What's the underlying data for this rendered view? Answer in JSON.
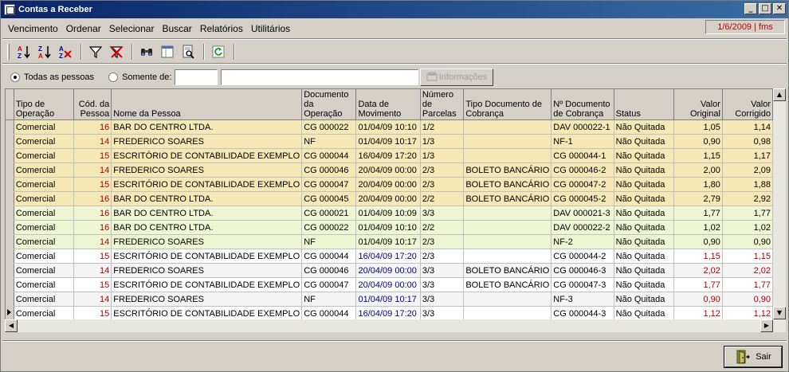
{
  "window": {
    "title": "Contas a Receber",
    "minimize": "_",
    "maximize": "□",
    "close": "✕"
  },
  "menu": [
    {
      "label": "Vencimento"
    },
    {
      "label": "Ordenar"
    },
    {
      "label": "Selecionar"
    },
    {
      "label": "Buscar"
    },
    {
      "label": "Relatórios"
    },
    {
      "label": "Utilitários"
    }
  ],
  "date_user": "1/6/2009 | fms",
  "toolbar": {
    "sort_asc": "sort-ascending-icon",
    "sort_desc": "sort-descending-icon",
    "clear_sort": "clear-sort-icon",
    "filter": "filter-icon",
    "clear_filter": "clear-filter-icon",
    "find": "binoculars-icon",
    "columns": "columns-icon",
    "preview": "print-preview-icon",
    "refresh": "refresh-icon"
  },
  "filter": {
    "all_label": "Todas as pessoas",
    "only_label": "Somente de:",
    "code_value": "",
    "name_value": "",
    "info_button": "Informações"
  },
  "table": {
    "headers": [
      "Tipo de Operação",
      "Cód. da Pessoa",
      "Nome da Pessoa",
      "Documento da Operação",
      "Data de Movimento",
      "Número de Parcelas",
      "Tipo Documento de Cobrança",
      "Nº Documento de Cobrança",
      "Status",
      "Valor Original",
      "Valor Corrigido"
    ],
    "rows": [
      {
        "tipo": "Comercial",
        "cod": "16",
        "nome": "BAR DO CENTRO LTDA.",
        "doc": "CG 000022",
        "data": "01/04/09 10:10",
        "parc": "1/2",
        "tipodoc": "",
        "ndoc": "DAV 000022-1",
        "status": "Não Quitada",
        "vorig": "1,05",
        "vcorr": "1,14"
      },
      {
        "tipo": "Comercial",
        "cod": "14",
        "nome": "FREDERICO SOARES",
        "doc": "NF",
        "data": "01/04/09 10:17",
        "parc": "1/3",
        "tipodoc": "",
        "ndoc": "NF-1",
        "status": "Não Quitada",
        "vorig": "0,90",
        "vcorr": "0,98"
      },
      {
        "tipo": "Comercial",
        "cod": "15",
        "nome": "ESCRITÓRIO DE CONTABILIDADE EXEMPLO",
        "doc": "CG 000044",
        "data": "16/04/09 17:20",
        "parc": "1/3",
        "tipodoc": "",
        "ndoc": "CG 000044-1",
        "status": "Não Quitada",
        "vorig": "1,15",
        "vcorr": "1,17"
      },
      {
        "tipo": "Comercial",
        "cod": "14",
        "nome": "FREDERICO SOARES",
        "doc": "CG 000046",
        "data": "20/04/09 00:00",
        "parc": "2/3",
        "tipodoc": "BOLETO BANCÁRIO",
        "ndoc": "CG 000046-2",
        "status": "Não Quitada",
        "vorig": "2,00",
        "vcorr": "2,09"
      },
      {
        "tipo": "Comercial",
        "cod": "15",
        "nome": "ESCRITÓRIO DE CONTABILIDADE EXEMPLO",
        "doc": "CG 000047",
        "data": "20/04/09 00:00",
        "parc": "2/3",
        "tipodoc": "BOLETO BANCÁRIO",
        "ndoc": "CG 000047-2",
        "status": "Não Quitada",
        "vorig": "1,80",
        "vcorr": "1,88"
      },
      {
        "tipo": "Comercial",
        "cod": "16",
        "nome": "BAR DO CENTRO LTDA.",
        "doc": "CG 000045",
        "data": "20/04/09 00:00",
        "parc": "2/2",
        "tipodoc": "BOLETO BANCÁRIO",
        "ndoc": "CG 000045-2",
        "status": "Não Quitada",
        "vorig": "2,79",
        "vcorr": "2,92"
      },
      {
        "tipo": "Comercial",
        "cod": "16",
        "nome": "BAR DO CENTRO LTDA.",
        "doc": "CG 000021",
        "data": "01/04/09 10:09",
        "parc": "3/3",
        "tipodoc": "",
        "ndoc": "DAV 000021-3",
        "status": "Não Quitada",
        "vorig": "1,77",
        "vcorr": "1,77"
      },
      {
        "tipo": "Comercial",
        "cod": "16",
        "nome": "BAR DO CENTRO LTDA.",
        "doc": "CG 000022",
        "data": "01/04/09 10:10",
        "parc": "2/2",
        "tipodoc": "",
        "ndoc": "DAV 000022-2",
        "status": "Não Quitada",
        "vorig": "1,02",
        "vcorr": "1,02"
      },
      {
        "tipo": "Comercial",
        "cod": "14",
        "nome": "FREDERICO SOARES",
        "doc": "NF",
        "data": "01/04/09 10:17",
        "parc": "2/3",
        "tipodoc": "",
        "ndoc": "NF-2",
        "status": "Não Quitada",
        "vorig": "0,90",
        "vcorr": "0,90"
      },
      {
        "tipo": "Comercial",
        "cod": "15",
        "nome": "ESCRITÓRIO DE CONTABILIDADE EXEMPLO",
        "doc": "CG 000044",
        "data": "16/04/09 17:20",
        "parc": "2/3",
        "tipodoc": "",
        "ndoc": "CG 000044-2",
        "status": "Não Quitada",
        "vorig": "1,15",
        "vcorr": "1,15"
      },
      {
        "tipo": "Comercial",
        "cod": "14",
        "nome": "FREDERICO SOARES",
        "doc": "CG 000046",
        "data": "20/04/09 00:00",
        "parc": "3/3",
        "tipodoc": "BOLETO BANCÁRIO",
        "ndoc": "CG 000046-3",
        "status": "Não Quitada",
        "vorig": "2,02",
        "vcorr": "2,02"
      },
      {
        "tipo": "Comercial",
        "cod": "15",
        "nome": "ESCRITÓRIO DE CONTABILIDADE EXEMPLO",
        "doc": "CG 000047",
        "data": "20/04/09 00:00",
        "parc": "3/3",
        "tipodoc": "BOLETO BANCÁRIO",
        "ndoc": "CG 000047-3",
        "status": "Não Quitada",
        "vorig": "1,77",
        "vcorr": "1,77"
      },
      {
        "tipo": "Comercial",
        "cod": "14",
        "nome": "FREDERICO SOARES",
        "doc": "NF",
        "data": "01/04/09 10:17",
        "parc": "3/3",
        "tipodoc": "",
        "ndoc": "NF-3",
        "status": "Não Quitada",
        "vorig": "0,90",
        "vcorr": "0,90"
      },
      {
        "tipo": "Comercial",
        "cod": "15",
        "nome": "ESCRITÓRIO DE CONTABILIDADE EXEMPLO",
        "doc": "CG 000044",
        "data": "16/04/09 17:20",
        "parc": "3/3",
        "tipodoc": "",
        "ndoc": "CG 000044-3",
        "status": "Não Quitada",
        "vorig": "1,12",
        "vcorr": "1,12"
      }
    ]
  },
  "colors": {
    "row_yellow": "#f5e8b4",
    "row_green": "#eef5d2",
    "value_red": "#b00000",
    "date_blue": "#000080",
    "date_box_red": "#c00000"
  },
  "sair_button": "Sair"
}
